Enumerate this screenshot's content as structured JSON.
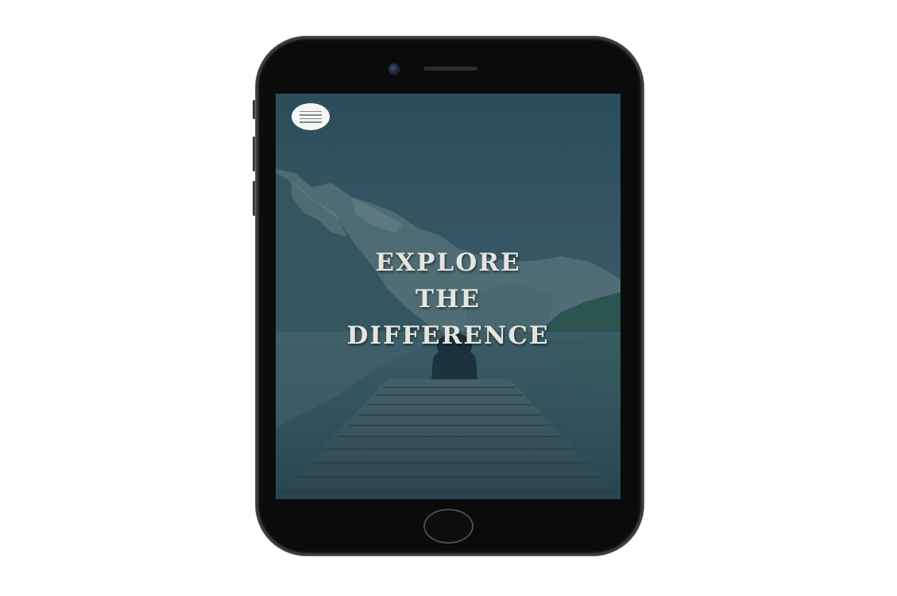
{
  "hero": {
    "lines": [
      "EXPLORE",
      "THE",
      "DIFFERENCE"
    ]
  },
  "menu": {
    "icon": "hamburger-menu-icon"
  },
  "device": {
    "type": "smartphone",
    "frame_color": "#0b0b0c"
  },
  "colors": {
    "overlay": "#173a48",
    "hero_text": "#e3e5de",
    "menu_button_bg": "#f5f6f5"
  }
}
